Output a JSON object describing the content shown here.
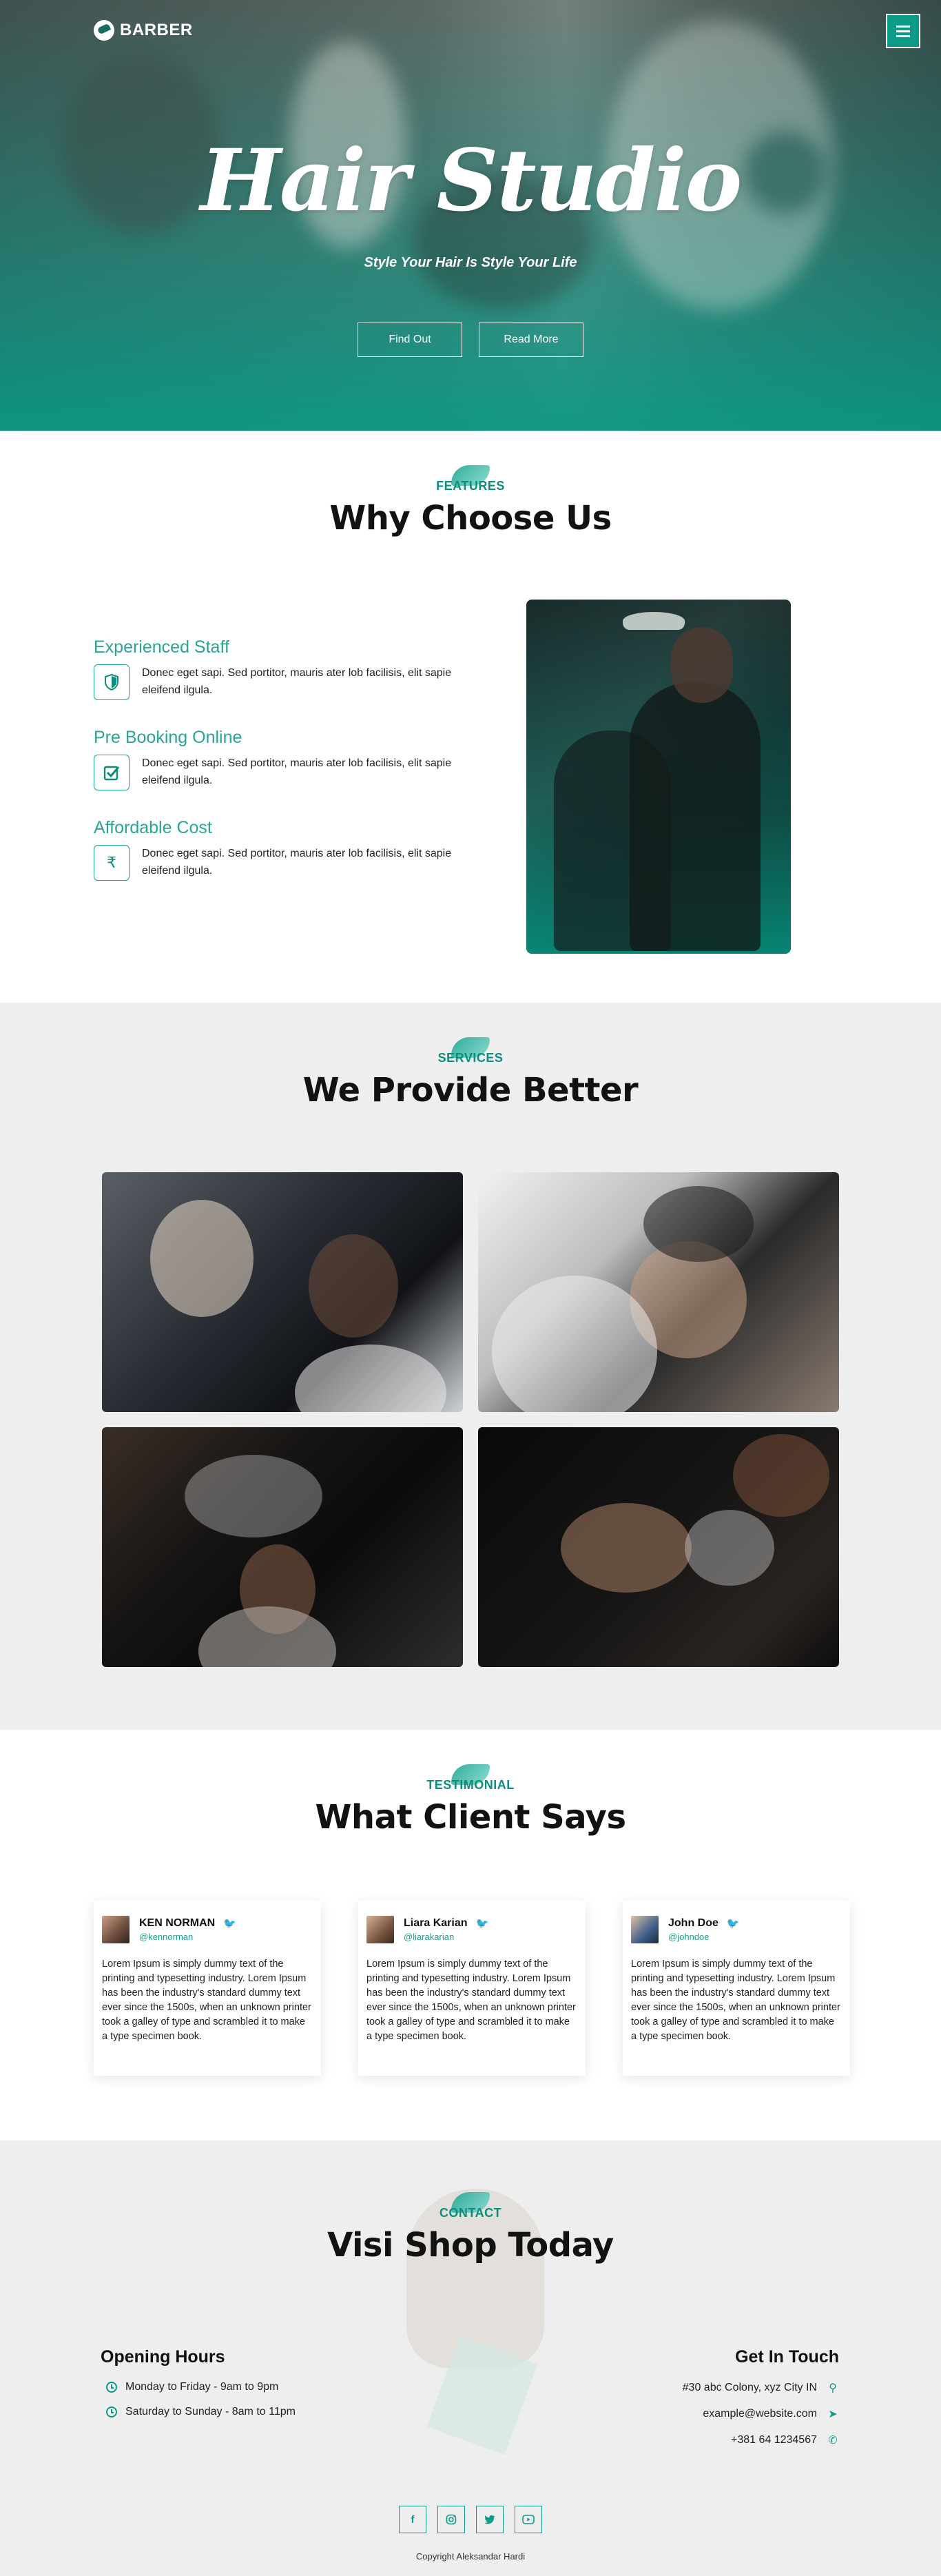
{
  "brand": {
    "name": "BARBER"
  },
  "hero": {
    "title": "Hair Studio",
    "subtitle": "Style Your Hair Is Style Your Life",
    "buttons": [
      "Find Out",
      "Read More"
    ]
  },
  "features": {
    "badge": "FEATURES",
    "title": "Why Choose Us",
    "items": [
      {
        "name": "Experienced Staff",
        "icon": "shield-icon",
        "desc": "Donec eget sapi. Sed portitor, mauris ater lob facilisis, elit sapie eleifend ilgula."
      },
      {
        "name": "Pre Booking Online",
        "icon": "checkbox-icon",
        "desc": "Donec eget sapi. Sed portitor, mauris ater lob facilisis, elit sapie eleifend ilgula."
      },
      {
        "name": "Affordable Cost",
        "icon": "rupee-icon",
        "desc": "Donec eget sapi. Sed portitor, mauris ater lob facilisis, elit sapie eleifend ilgula."
      }
    ]
  },
  "services": {
    "badge": "SERVICES",
    "title": "We Provide Better"
  },
  "testimonial": {
    "badge": "TESTIMONIAL",
    "title": "What Client Says",
    "cards": [
      {
        "name": "KEN NORMAN",
        "handle": "@kennorman",
        "text": "Lorem Ipsum is simply dummy text of the printing and typesetting industry. Lorem Ipsum has been the industry's standard dummy text ever since the 1500s, when an unknown printer took a galley of type and scrambled it to make a type specimen book."
      },
      {
        "name": "Liara Karian",
        "handle": "@liarakarian",
        "text": "Lorem Ipsum is simply dummy text of the printing and typesetting industry. Lorem Ipsum has been the industry's standard dummy text ever since the 1500s, when an unknown printer took a galley of type and scrambled it to make a type specimen book."
      },
      {
        "name": "John Doe",
        "handle": "@johndoe",
        "text": "Lorem Ipsum is simply dummy text of the printing and typesetting industry. Lorem Ipsum has been the industry's standard dummy text ever since the 1500s, when an unknown printer took a galley of type and scrambled it to make a type specimen book."
      }
    ]
  },
  "contact": {
    "badge": "CONTACT",
    "title": "Visi Shop Today",
    "hours_title": "Opening Hours",
    "hours": [
      "Monday to Friday - 9am to 9pm",
      "Saturday to Sunday - 8am to 11pm"
    ],
    "touch_title": "Get In Touch",
    "address": "#30 abc Colony, xyz City IN",
    "email": "example@website.com",
    "phone": "+381 64 1234567"
  },
  "footer": {
    "socials": [
      "facebook-icon",
      "instagram-icon",
      "twitter-icon",
      "youtube-icon"
    ],
    "copyright": "Copyright Aleksandar Hardi"
  },
  "colors": {
    "accent": "#0b9a87",
    "accent_light": "#29a595",
    "section_gray": "#eeeeee"
  }
}
